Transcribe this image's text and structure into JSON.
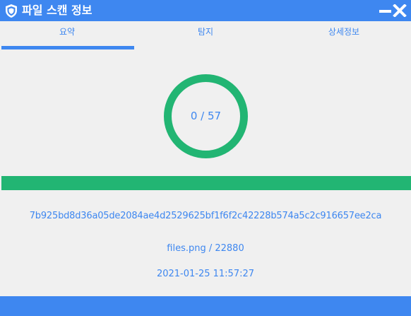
{
  "window": {
    "title": "파일 스캔 정보",
    "colors": {
      "accent": "#3e87f0",
      "success": "#22b573",
      "background": "#f0f0f0"
    },
    "icons": {
      "app": "shield-icon",
      "minimize": "minimize-icon",
      "close": "close-icon"
    }
  },
  "tabs": [
    {
      "label": "요약",
      "active": true
    },
    {
      "label": "탐지",
      "active": false
    },
    {
      "label": "상세정보",
      "active": false
    }
  ],
  "summary": {
    "detection_ratio": "0 / 57",
    "detected": 0,
    "total_engines": 57,
    "progress": 1.0,
    "hash": "7b925bd8d36a05de2084ae4d2529625bf1f6f2c42228b574a5c2c916657ee2ca",
    "file_info": "files.png / 22880",
    "timestamp": "2021-01-25 11:57:27"
  }
}
